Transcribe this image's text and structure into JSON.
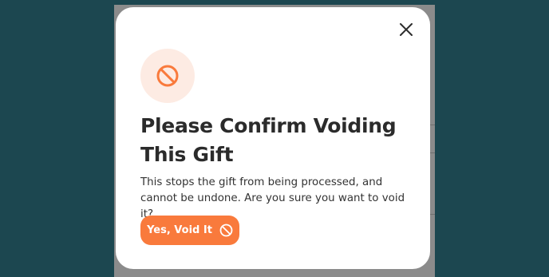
{
  "modal": {
    "title": "Please Confirm Voiding This Gift",
    "description": "This stops the gift from being processed, and cannot be undone. Are you sure you want to void it?",
    "confirm_label": "Yes, Void It",
    "icons": {
      "header": "prohibited-icon",
      "close": "close-icon",
      "button": "prohibited-icon"
    }
  },
  "colors": {
    "accent": "#f97a3c",
    "icon_bg": "#fdebe3",
    "backdrop": "#1c4750",
    "text": "#2b2b2b"
  }
}
